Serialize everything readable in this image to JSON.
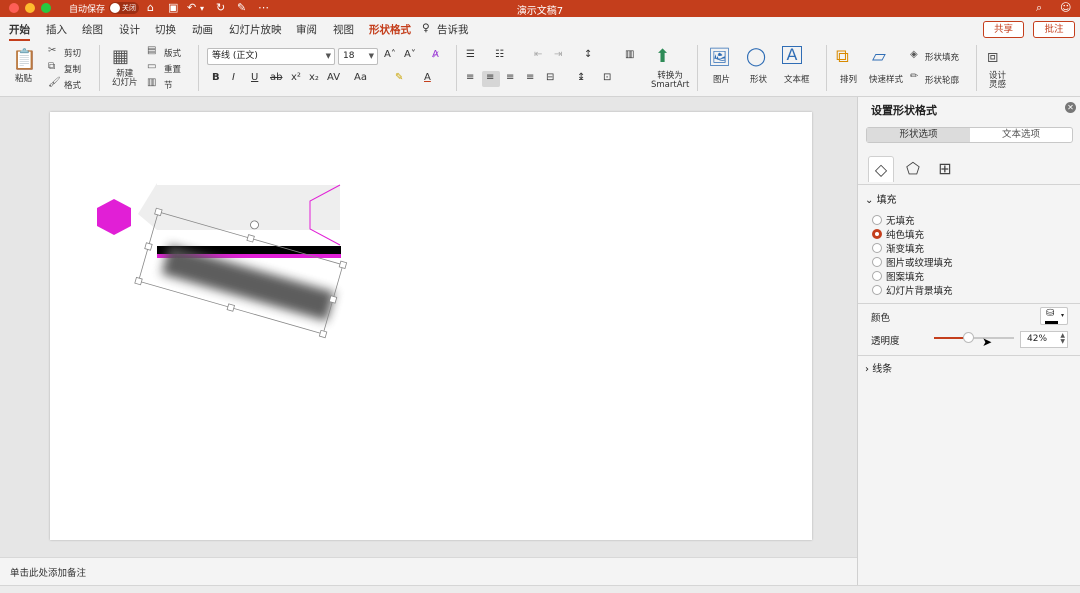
{
  "titlebar": {
    "autosave_label": "自动保存",
    "autosave_state": "关闭",
    "doc_title": "演示文稿7"
  },
  "tabs": [
    "开始",
    "插入",
    "绘图",
    "设计",
    "切换",
    "动画",
    "幻灯片放映",
    "审阅",
    "视图",
    "形状格式"
  ],
  "tell_me": "告诉我",
  "share": "共享",
  "comment": "批注",
  "ribbon": {
    "paste": "粘贴",
    "cut": "剪切",
    "copy": "复制",
    "format": "格式",
    "new_slide": "新建\n幻灯片",
    "layout": "版式",
    "reset": "重置",
    "section": "节",
    "font_name": "等线 (正文)",
    "font_size": "18",
    "convert_smartart": "转换为\nSmartArt",
    "picture": "图片",
    "shape": "形状",
    "textbox": "文本框",
    "arrange": "排列",
    "quick_styles": "快速样式",
    "shape_fill": "形状填充",
    "shape_outline": "形状轮廓",
    "designer": "设计\n灵感"
  },
  "notes_placeholder": "单击此处添加备注",
  "panel": {
    "title": "设置形状格式",
    "seg_shape": "形状选项",
    "seg_text": "文本选项",
    "fill_section": "填充",
    "fill_options": [
      "无填充",
      "纯色填充",
      "渐变填充",
      "图片或纹理填充",
      "图案填充",
      "幻灯片背景填充"
    ],
    "fill_selected_index": 1,
    "color_label": "颜色",
    "transparency_label": "透明度",
    "transparency_value": "42%",
    "transparency_fraction": 0.42,
    "line_section": "线条"
  },
  "colors": {
    "accent": "#c43e1c",
    "magenta": "#e11fd6"
  }
}
